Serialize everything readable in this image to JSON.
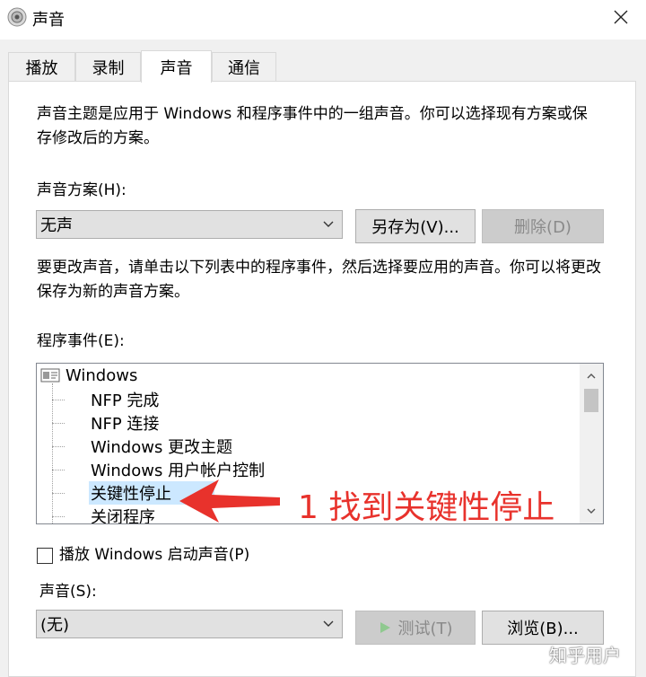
{
  "window": {
    "title": "声音"
  },
  "tabs": [
    {
      "label": "播放"
    },
    {
      "label": "录制"
    },
    {
      "label": "声音"
    },
    {
      "label": "通信"
    }
  ],
  "panel": {
    "intro": "声音主题是应用于 Windows 和程序事件中的一组声音。你可以选择现有方案或保存修改后的方案。",
    "scheme_label": "声音方案(H):",
    "scheme_value": "无声",
    "save_as_label": "另存为(V)...",
    "delete_label": "删除(D)",
    "change_help": "要更改声音，请单击以下列表中的程序事件，然后选择要应用的声音。你可以将更改保存为新的声音方案。",
    "events_label": "程序事件(E):",
    "events": {
      "root": "Windows",
      "items": [
        "NFP 完成",
        "NFP 连接",
        "Windows 更改主题",
        "Windows 用户帐户控制",
        "关键性停止",
        "关闭程序"
      ],
      "selected_index": 4
    },
    "startup_sound_label": "播放 Windows 启动声音(P)",
    "startup_sound_checked": false,
    "sound_label": "声音(S):",
    "sound_value": "(无)",
    "test_label": "测试(T)",
    "browse_label": "浏览(B)..."
  },
  "annotation": {
    "text": "1 找到关键性停止",
    "color": "#e8322c"
  },
  "watermark": "知乎用户"
}
